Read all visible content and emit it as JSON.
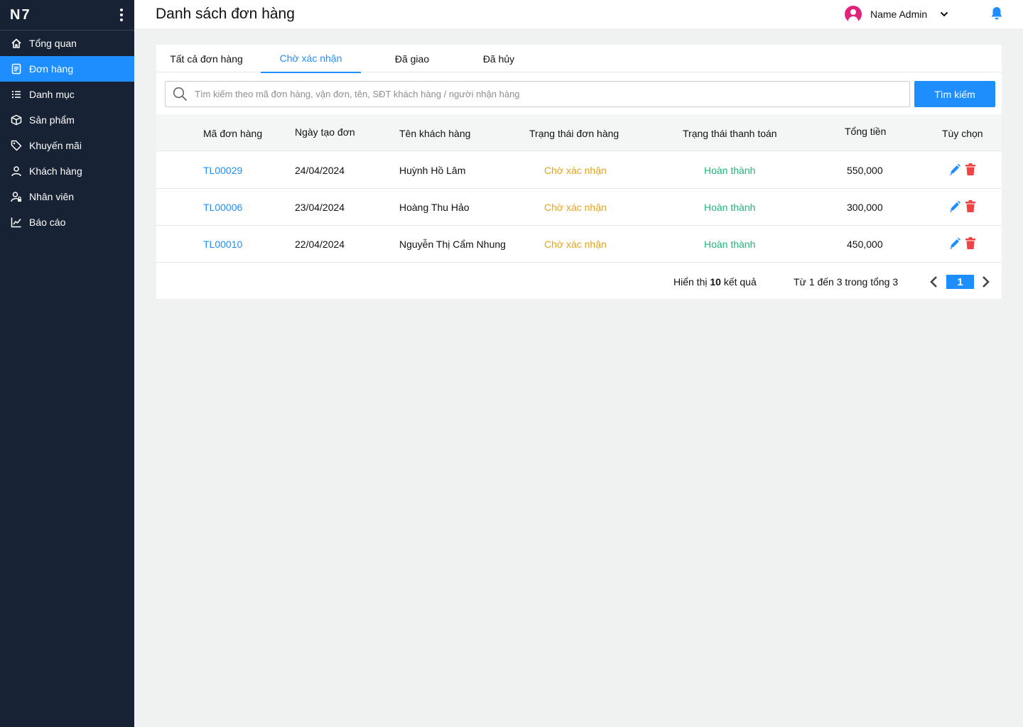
{
  "sidebar": {
    "brand": "N7",
    "items": [
      {
        "label": "Tổng quan",
        "icon": "home-icon"
      },
      {
        "label": "Đơn hàng",
        "icon": "document-icon",
        "active": true
      },
      {
        "label": "Danh mục",
        "icon": "list-icon"
      },
      {
        "label": "Sản phẩm",
        "icon": "box-icon"
      },
      {
        "label": "Khuyến mãi",
        "icon": "tag-icon"
      },
      {
        "label": "Khách hàng",
        "icon": "user-icon"
      },
      {
        "label": "Nhân viên",
        "icon": "user-lock-icon"
      },
      {
        "label": "Báo cáo",
        "icon": "line-chart-icon"
      }
    ]
  },
  "header": {
    "title": "Danh sách đơn hàng",
    "user_name": "Name Admin"
  },
  "tabs": [
    {
      "label": "Tất cả đơn hàng",
      "active": false
    },
    {
      "label": "Chờ xác nhận",
      "active": true
    },
    {
      "label": "Đã giao",
      "active": false
    },
    {
      "label": "Đã hủy",
      "active": false
    }
  ],
  "search": {
    "placeholder": "Tìm kiếm theo mã đơn hàng, vận đơn, tên, SĐT khách hàng / người nhận hàng",
    "value": "",
    "button_label": "Tìm kiếm"
  },
  "table": {
    "columns": [
      "Mã đơn hàng",
      "Ngày tạo đơn",
      "Tên khách hàng",
      "Trạng thái đơn hàng",
      "Trạng thái thanh toán",
      "Tổng tiền",
      "Tùy chọn"
    ],
    "rows": [
      {
        "code": "TL00029",
        "date": "24/04/2024",
        "customer": "Huỳnh Hồ Lâm",
        "order_status": "Chờ xác nhận",
        "payment_status": "Hoàn thành",
        "total": "550,000"
      },
      {
        "code": "TL00006",
        "date": "23/04/2024",
        "customer": "Hoàng Thu Hảo",
        "order_status": "Chờ xác nhận",
        "payment_status": "Hoàn thành",
        "total": "300,000"
      },
      {
        "code": "TL00010",
        "date": "22/04/2024",
        "customer": "Nguyễn Thị Cẩm Nhung",
        "order_status": "Chờ xác nhận",
        "payment_status": "Hoàn thành",
        "total": "450,000"
      }
    ]
  },
  "pagination": {
    "show_prefix": "Hiển thị",
    "page_size": "10",
    "show_suffix": "kết quả",
    "range_text": "Từ 1 đến 3 trong tổng 3",
    "current_page": "1"
  },
  "colors": {
    "accent": "#1e8eff",
    "sidebar_bg": "#172234",
    "pending": "#e8a317",
    "success": "#1fb57a",
    "danger": "#ef4444",
    "avatar": "#e0247a"
  }
}
